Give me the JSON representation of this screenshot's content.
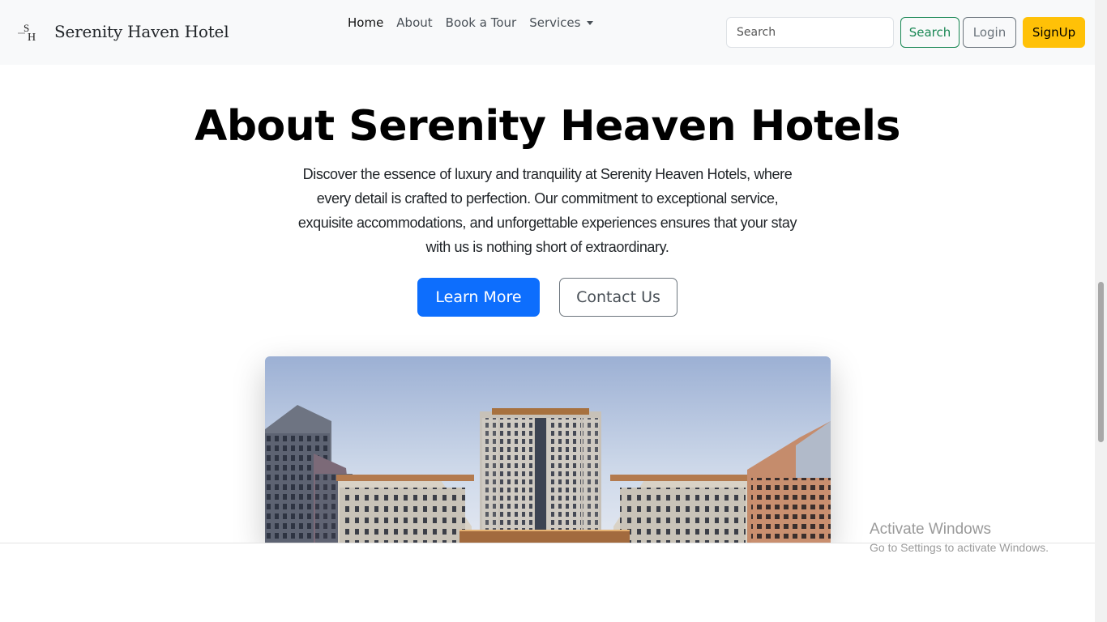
{
  "navbar": {
    "brand_name": "Serenity Haven Hotel",
    "brand_logo_letters": "SH",
    "links": [
      "Home",
      "About",
      "Book a Tour"
    ],
    "services_label": "Services",
    "search_placeholder": "Search",
    "search_button": "Search",
    "login_button": "Login",
    "signup_button": "SignUp"
  },
  "hero": {
    "title": "About Serenity Heaven Hotels",
    "lead": "Discover the essence of luxury and tranquility at Serenity Heaven Hotels, where every detail is crafted to perfection. Our commitment to exceptional service, exquisite accommodations, and unforgettable experiences ensures that your stay with us is nothing short of extraordinary.",
    "learn_more": "Learn More",
    "contact_us": "Contact Us"
  },
  "watermark": {
    "title": "Activate Windows",
    "subtitle": "Go to Settings to activate Windows."
  },
  "colors": {
    "primary": "#0d6efd",
    "success": "#198754",
    "warning": "#ffc107",
    "navbar_bg": "#f8f9fa"
  }
}
